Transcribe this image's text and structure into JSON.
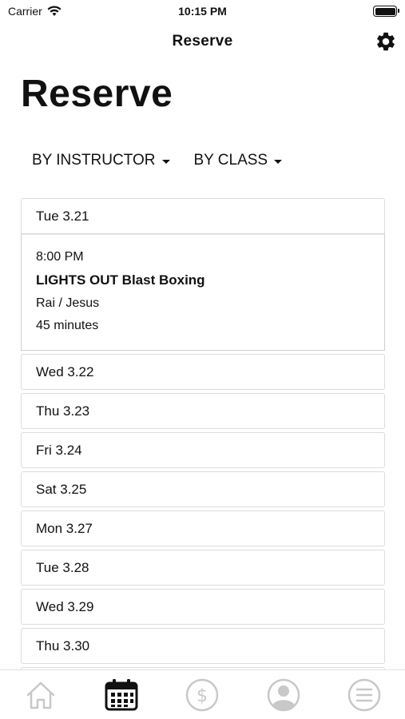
{
  "status_bar": {
    "carrier": "Carrier",
    "time": "10:15 PM"
  },
  "nav": {
    "title": "Reserve",
    "settings_icon": "gear-icon"
  },
  "page": {
    "title": "Reserve"
  },
  "filters": [
    {
      "label": "BY INSTRUCTOR"
    },
    {
      "label": "BY CLASS"
    }
  ],
  "schedule": {
    "days": [
      {
        "label": "Tue 3.21"
      },
      {
        "label": "Wed 3.22"
      },
      {
        "label": "Thu 3.23"
      },
      {
        "label": "Fri 3.24"
      },
      {
        "label": "Sat 3.25"
      },
      {
        "label": "Mon 3.27"
      },
      {
        "label": "Tue 3.28"
      },
      {
        "label": "Wed 3.29"
      },
      {
        "label": "Thu 3.30"
      }
    ],
    "expanded_class": {
      "time": "8:00 PM",
      "name": "LIGHTS OUT Blast Boxing",
      "instructors": "Rai / Jesus",
      "duration": "45 minutes"
    }
  },
  "tabs": [
    {
      "icon": "home-icon",
      "selected": false
    },
    {
      "icon": "calendar-icon",
      "selected": true
    },
    {
      "icon": "dollar-icon",
      "selected": false
    },
    {
      "icon": "profile-icon",
      "selected": false
    },
    {
      "icon": "menu-icon",
      "selected": false
    }
  ],
  "colors": {
    "text": "#111111",
    "inactive_icon": "#c8c8c8",
    "border": "#dcdcdc"
  }
}
